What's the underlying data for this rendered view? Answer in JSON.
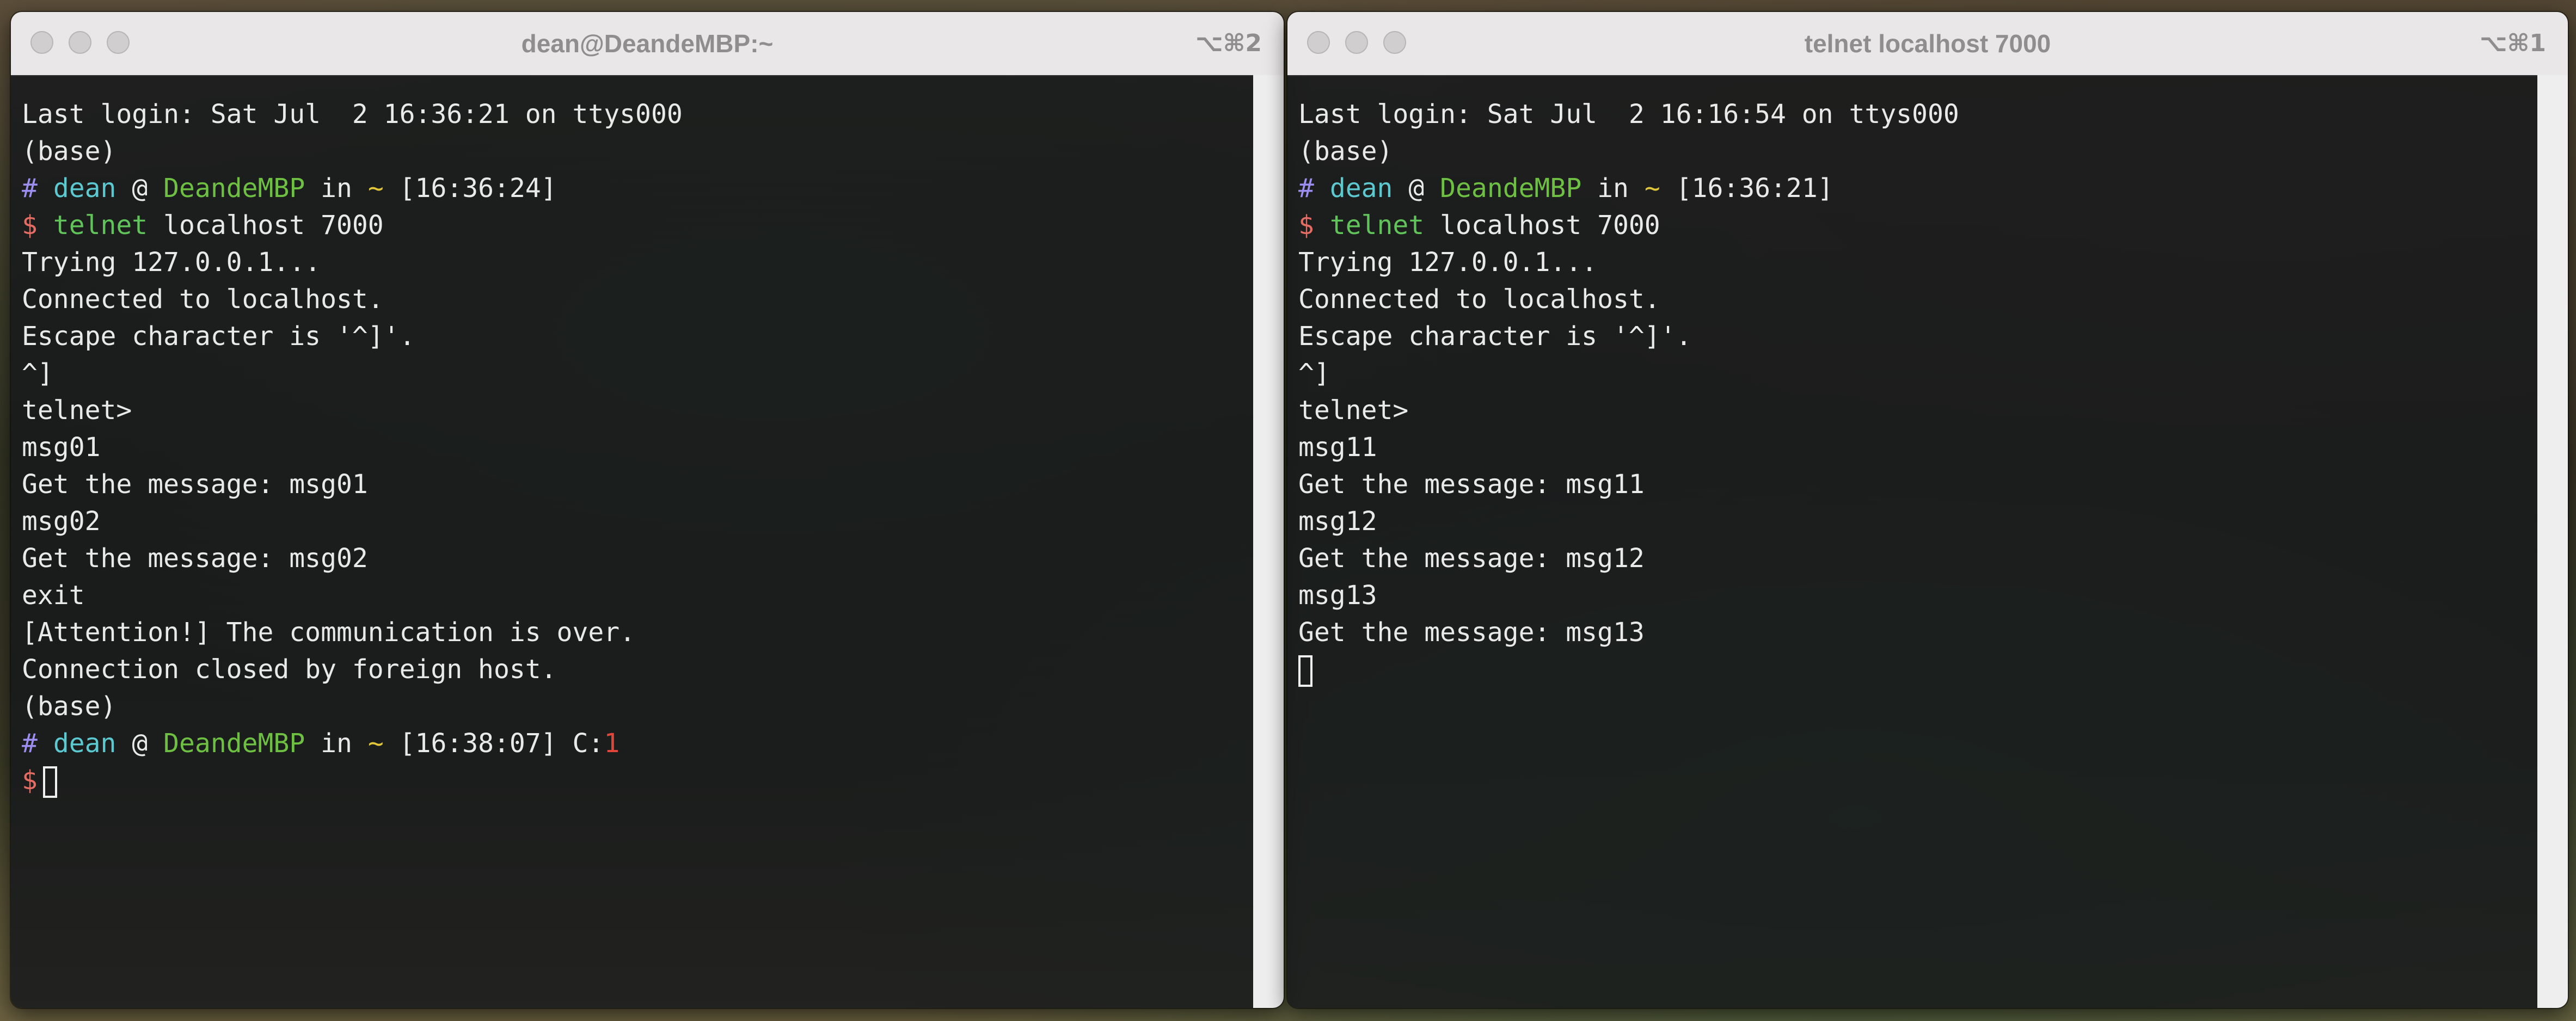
{
  "left_window": {
    "title": "dean@DeandeMBP:~",
    "shortcut": "⌥⌘2",
    "last_login": "Last login: Sat Jul  2 16:36:21 on ttys000",
    "env_1": "(base)",
    "prompt_1": {
      "hash": "#",
      "user": "dean",
      "at": "@",
      "host": "DeandeMBP",
      "in": "in",
      "dir": "~",
      "time": "[16:36:24]"
    },
    "cmd_1": {
      "dollar": "$",
      "program": "telnet",
      "args": "localhost 7000"
    },
    "output": [
      "Trying 127.0.0.1...",
      "Connected to localhost.",
      "Escape character is '^]'.",
      "^]",
      "telnet>",
      "msg01",
      "Get the message: msg01",
      "msg02",
      "Get the message: msg02",
      "exit",
      "[Attention!] The communication is over.",
      "Connection closed by foreign host.",
      "(base)"
    ],
    "prompt_2": {
      "hash": "#",
      "user": "dean",
      "at": "@",
      "host": "DeandeMBP",
      "in": "in",
      "dir": "~",
      "time": "[16:38:07]",
      "code_label": "C:",
      "code": "1"
    },
    "cmd_2": {
      "dollar": "$"
    }
  },
  "right_window": {
    "title": "telnet localhost 7000",
    "shortcut": "⌥⌘1",
    "last_login": "Last login: Sat Jul  2 16:16:54 on ttys000",
    "env_1": "(base)",
    "prompt_1": {
      "hash": "#",
      "user": "dean",
      "at": "@",
      "host": "DeandeMBP",
      "in": "in",
      "dir": "~",
      "time": "[16:36:21]"
    },
    "cmd_1": {
      "dollar": "$",
      "program": "telnet",
      "args": "localhost 7000"
    },
    "output": [
      "Trying 127.0.0.1...",
      "Connected to localhost.",
      "Escape character is '^]'.",
      "^]",
      "telnet>",
      "msg11",
      "Get the message: msg11",
      "msg12",
      "Get the message: msg12",
      "msg13",
      "Get the message: msg13"
    ]
  },
  "colors": {
    "prompt_hash": "#9c8ef0",
    "user": "#5cc8d0",
    "host": "#6ec043",
    "dir": "#e2c63a",
    "dollar": "#e56c63",
    "command": "#61c45a",
    "exit_code": "#e2463b",
    "text": "#e9e9e9"
  }
}
